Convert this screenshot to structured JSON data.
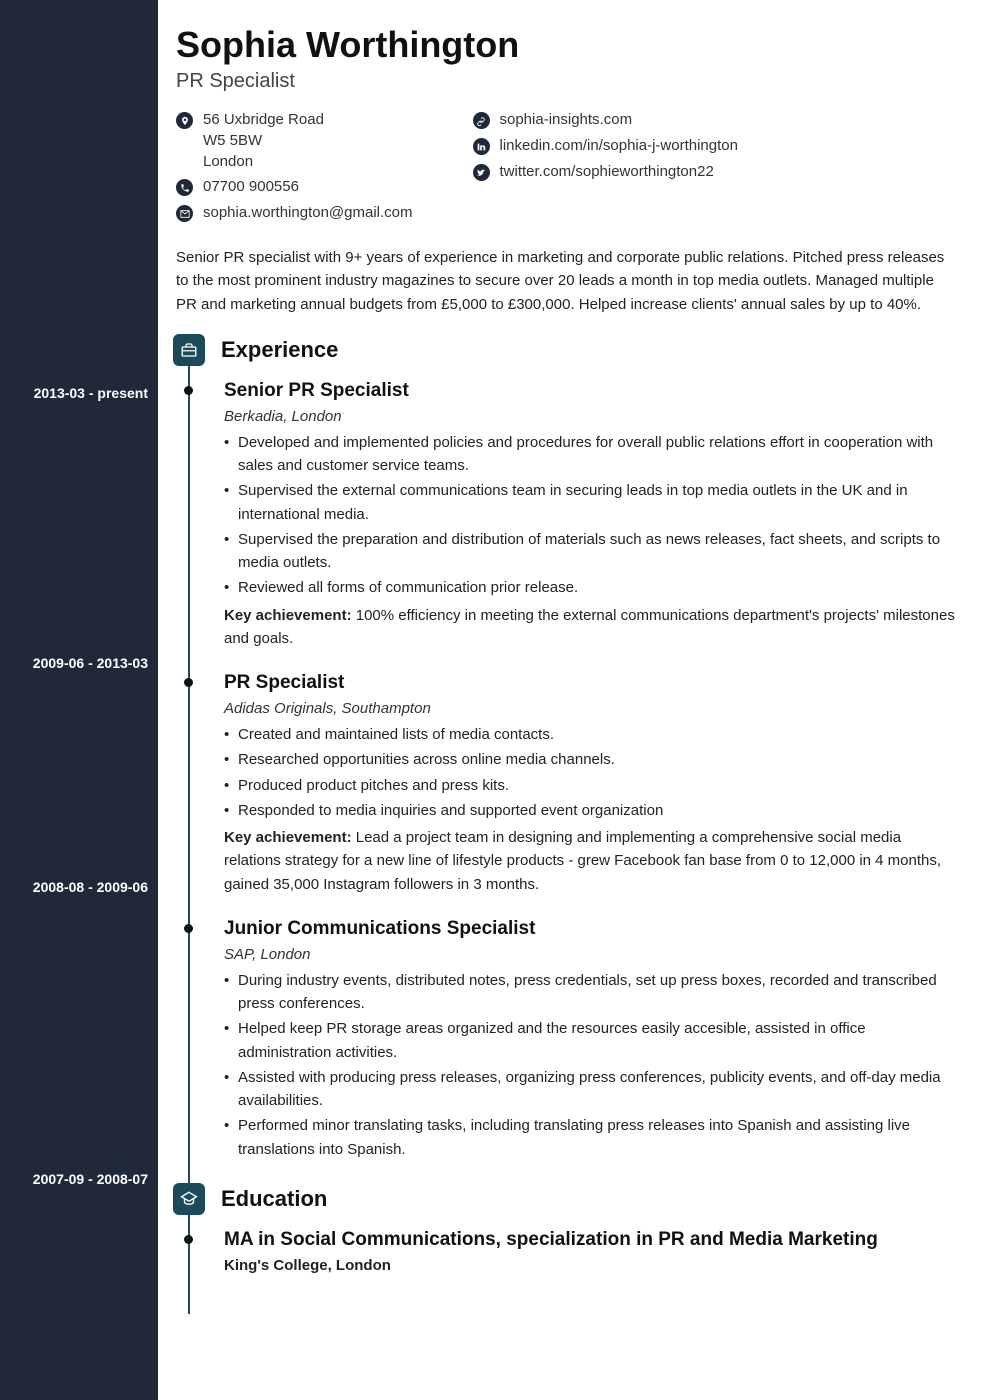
{
  "header": {
    "name": "Sophia Worthington",
    "title": "PR Specialist"
  },
  "contact": {
    "address": {
      "line1": "56 Uxbridge Road",
      "line2": "W5 5BW",
      "line3": "London"
    },
    "phone": "07700 900556",
    "email": "sophia.worthington@gmail.com",
    "website": "sophia-insights.com",
    "linkedin": "linkedin.com/in/sophia-j-worthington",
    "twitter": "twitter.com/sophieworthington22"
  },
  "summary": "Senior PR specialist with 9+ years of experience in marketing and corporate public relations. Pitched press releases to the most prominent industry magazines to secure over 20 leads a month in top media outlets. Managed multiple PR and marketing annual budgets from £5,000 to £300,000. Helped increase clients' annual sales by up to 40%.",
  "sections": {
    "experience": "Experience",
    "education": "Education"
  },
  "experience": [
    {
      "dates": "2013-03 - present",
      "role": "Senior PR Specialist",
      "org": "Berkadia, London",
      "bullets": [
        "Developed and implemented policies and procedures for overall public relations effort in cooperation with sales and customer service teams.",
        "Supervised the external communications team in securing leads in top media outlets in the UK and in international media.",
        "Supervised the preparation and distribution of materials such as news releases, fact sheets, and scripts to media outlets.",
        "Reviewed all forms of communication prior release."
      ],
      "achievement_label": "Key achievement:",
      "achievement": " 100% efficiency in meeting the external communications department's projects' milestones and goals."
    },
    {
      "dates": "2009-06 - 2013-03",
      "role": "PR Specialist",
      "org": "Adidas Originals, Southampton",
      "bullets": [
        "Created and maintained lists of media contacts.",
        "Researched opportunities across online media channels.",
        "Produced product pitches and press kits.",
        "Responded to media inquiries and supported event organization"
      ],
      "achievement_label": "Key achievement:",
      "achievement": " Lead a project team in designing and implementing a comprehensive social media relations strategy for a new line of lifestyle products - grew Facebook fan base from 0 to 12,000 in 4 months, gained 35,000 Instagram followers in 3 months."
    },
    {
      "dates": "2008-08 - 2009-06",
      "role": "Junior Communications Specialist",
      "org": "SAP, London",
      "bullets": [
        "During industry events, distributed notes, press credentials, set up press boxes, recorded and transcribed press conferences.",
        "Helped keep PR storage areas organized and the resources easily accesible, assisted in office administration activities.",
        "Assisted with producing press releases, organizing press conferences, publicity events, and off-day media availabilities.",
        "Performed minor translating tasks, including translating press releases into Spanish and assisting live translations into Spanish."
      ]
    }
  ],
  "education": [
    {
      "dates": "2007-09 - 2008-07",
      "degree": "MA in Social Communications, specialization in PR and Media Marketing",
      "school": "King's College, London"
    }
  ],
  "date_positions": {
    "exp0": 385,
    "exp1": 655,
    "exp2": 879,
    "edu0": 1171
  }
}
